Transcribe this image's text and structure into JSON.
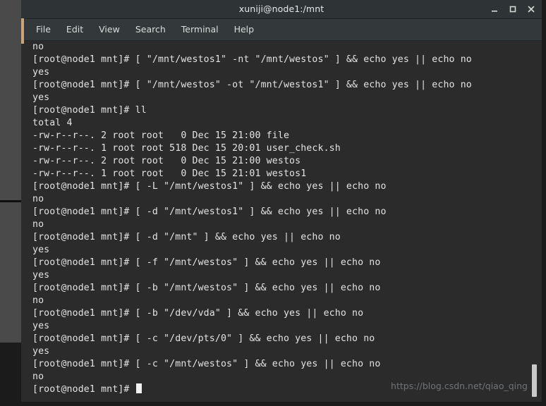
{
  "window": {
    "title": "xuniji@node1:/mnt",
    "controls": [
      {
        "name": "minimize-button",
        "label": "_"
      },
      {
        "name": "maximize-button",
        "label": "□"
      },
      {
        "name": "close-button",
        "label": "×"
      }
    ]
  },
  "menu": {
    "items": [
      {
        "label": "File"
      },
      {
        "label": "Edit"
      },
      {
        "label": "View"
      },
      {
        "label": "Search"
      },
      {
        "label": "Terminal"
      },
      {
        "label": "Help"
      }
    ]
  },
  "terminal": {
    "prompt": "[root@node1 mnt]# ",
    "cursor_visible": true,
    "lines": [
      "no",
      "[root@node1 mnt]# [ \"/mnt/westos1\" -nt \"/mnt/westos\" ] && echo yes || echo no",
      "yes",
      "[root@node1 mnt]# [ \"/mnt/westos\" -ot \"/mnt/westos1\" ] && echo yes || echo no",
      "yes",
      "[root@node1 mnt]# ll",
      "total 4",
      "-rw-r--r--. 2 root root   0 Dec 15 21:00 file",
      "-rw-r--r--. 1 root root 518 Dec 15 20:01 user_check.sh",
      "-rw-r--r--. 2 root root   0 Dec 15 21:00 westos",
      "-rw-r--r--. 1 root root   0 Dec 15 21:01 westos1",
      "[root@node1 mnt]# [ -L \"/mnt/westos1\" ] && echo yes || echo no",
      "no",
      "[root@node1 mnt]# [ -d \"/mnt/westos1\" ] && echo yes || echo no",
      "no",
      "[root@node1 mnt]# [ -d \"/mnt\" ] && echo yes || echo no",
      "yes",
      "[root@node1 mnt]# [ -f \"/mnt/westos\" ] && echo yes || echo no",
      "yes",
      "[root@node1 mnt]# [ -b \"/mnt/westos\" ] && echo yes || echo no",
      "no",
      "[root@node1 mnt]# [ -b \"/dev/vda\" ] && echo yes || echo no",
      "yes",
      "[root@node1 mnt]# [ -c \"/dev/pts/0\" ] && echo yes || echo no",
      "yes",
      "[root@node1 mnt]# [ -c \"/mnt/westos\" ] && echo yes || echo no",
      "no"
    ],
    "last_prompt": "[root@node1 mnt]# "
  },
  "watermark": {
    "text": "https://blog.csdn.net/qiao_qing"
  },
  "colors": {
    "title_bar": "#2e3436",
    "menu_bar": "#33393b",
    "terminal_bg": "#2b2b2b",
    "terminal_fg": "#e3e3e3",
    "accent": "#c8a57b",
    "scrollbar_thumb": "#c9c9c9",
    "watermark": "#6f7477"
  }
}
